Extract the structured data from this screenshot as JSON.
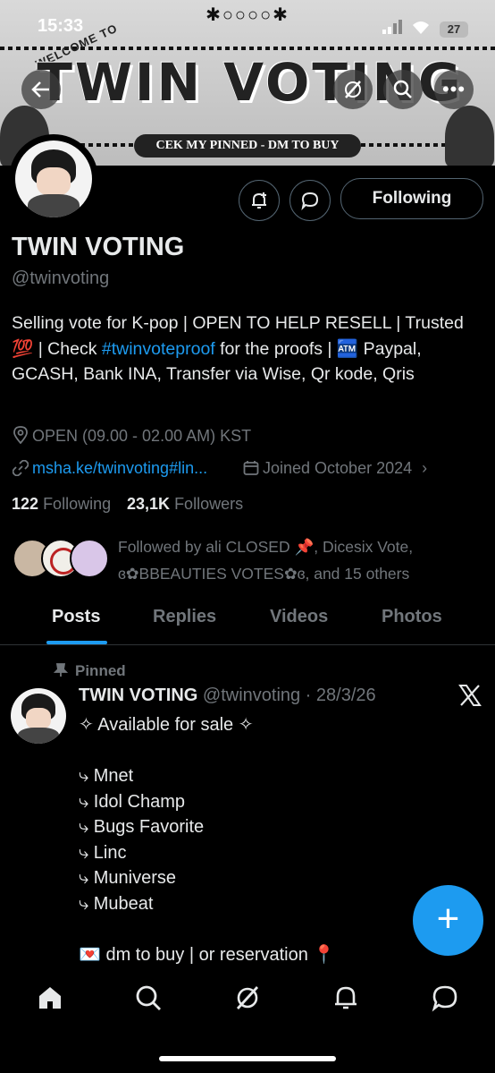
{
  "status_bar": {
    "time": "15:33",
    "battery": "27"
  },
  "banner": {
    "title": "TWIN VOTING",
    "welcome": "WELCOME TO",
    "pin_banner": "CEK MY PINNED - DM TO BUY",
    "deco": "✱○○○○✱"
  },
  "profile": {
    "name": "TWIN VOTING",
    "handle": "@twinvoting",
    "bio_parts": {
      "p1": "Selling vote for K-pop | OPEN TO HELP RESELL | Trusted 💯 | Check ",
      "hashtag": "#twinvoteproof",
      "p2": " for the proofs | 🏧 Paypal, GCASH, Bank INA, Transfer via Wise, Qr kode, Qris"
    },
    "location": "OPEN (09.00  - 02.00 AM) KST",
    "website": "msha.ke/twinvoting#lin...",
    "joined": "Joined October 2024",
    "following_count": "122",
    "following_label": "Following",
    "followers_count": "23,1K",
    "followers_label": "Followers",
    "followed_by_line1": "Followed by ali CLOSED 📌, Dicesix Vote,",
    "followed_by_line2": "ɞ✿BBEAUTIES VOTES✿ɞ, and 15 others",
    "follow_button": "Following"
  },
  "tabs": [
    "Posts",
    "Replies",
    "Videos",
    "Photos"
  ],
  "pinned_post": {
    "pinned_label": "Pinned",
    "author": "TWIN VOTING",
    "handle_date": "@twinvoting · 28/3/26",
    "lines": [
      "✧ Available for sale ✧",
      "",
      "⤷ Mnet",
      "⤷ Idol Champ",
      "⤷ Bugs Favorite",
      "⤷ Linc",
      "⤷ Muniverse",
      "⤷ Mubeat",
      "",
      "💌 dm to buy | or reservation 📍"
    ]
  },
  "fab_label": "+",
  "colors": {
    "accent": "#1d9bf0",
    "muted": "#71767b",
    "text": "#e7e9ea",
    "background": "#000000"
  }
}
